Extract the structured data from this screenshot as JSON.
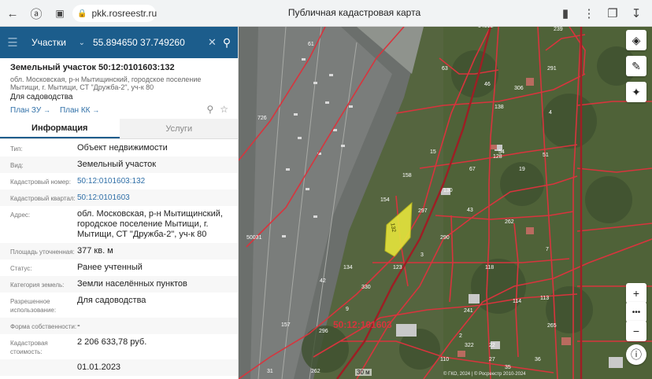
{
  "browser": {
    "url": "pkk.rosreestr.ru",
    "page_title": "Публичная кадастровая карта"
  },
  "search": {
    "type": "Участки",
    "query": "55.894650 37.749260"
  },
  "plot": {
    "title": "Земельный участок 50:12:0101603:132",
    "address": "обл. Московская, р-н Мытищинский, городское поселение Мытищи, г. Мытищи, СТ \"Дружба-2\", уч-к 80",
    "usage": "Для садоводства",
    "plan_zu": "План ЗУ",
    "plan_kk": "План КК"
  },
  "tabs": [
    "Информация",
    "Услуги"
  ],
  "properties": [
    {
      "label": "Тип:",
      "value": "Объект недвижимости"
    },
    {
      "label": "Вид:",
      "value": "Земельный участок"
    },
    {
      "label": "Кадастровый номер:",
      "value": "50:12:0101603:132",
      "link": true
    },
    {
      "label": "Кадастровый квартал:",
      "value": "50:12:0101603",
      "link": true
    },
    {
      "label": "Адрес:",
      "value": "обл. Московская, р-н Мытищинский, городское поселение Мытищи, г. Мытищи, СТ \"Дружба-2\", уч-к 80"
    },
    {
      "label": "Площадь уточненная:",
      "value": "377 кв. м"
    },
    {
      "label": "Статус:",
      "value": "Ранее учтенный"
    },
    {
      "label": "Категория земель:",
      "value": "Земли населённых пунктов"
    },
    {
      "label": "Разрешенное использование:",
      "value": "Для садоводства"
    },
    {
      "label": "Форма собственности:",
      "value": "-"
    },
    {
      "label": "Кадастровая стоимость:",
      "value": "2 206 633,78 руб."
    },
    {
      "label": "",
      "value": "01.01.2023"
    }
  ],
  "map": {
    "quarter_label": "50:12:101603",
    "highlighted_plot": "132",
    "scale": "30 м",
    "attribution": "© ГКО, 2024 | © Росреестр 2010-2024",
    "plot_numbers": [
      "61",
      "726",
      "50031",
      "63",
      "54512",
      "239",
      "291",
      "306",
      "46",
      "138",
      "4",
      "128",
      "54",
      "51",
      "19",
      "15",
      "158",
      "67",
      "130",
      "154",
      "43",
      "297",
      "262",
      "290",
      "3",
      "7",
      "134",
      "123",
      "118",
      "42",
      "330",
      "9",
      "114",
      "113",
      "157",
      "296",
      "241",
      "265",
      "322",
      "22",
      "110",
      "31",
      "262",
      "2",
      "27",
      "36",
      "35"
    ]
  },
  "colors": {
    "header_blue": "#1c5d8c",
    "link_blue": "#2f6fa7",
    "boundary_red": "#d8343d",
    "highlight_yellow": "#e6e43c"
  }
}
